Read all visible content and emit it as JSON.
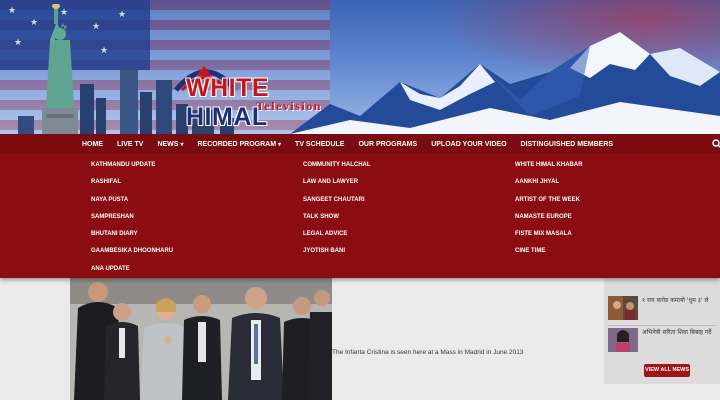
{
  "brand": {
    "logo_main_white": "WHITE",
    "logo_main_himal": " HIMAL",
    "logo_sub": "Television"
  },
  "nav": {
    "items": [
      {
        "label": "HOME"
      },
      {
        "label": "LIVE TV"
      },
      {
        "label": "NEWS",
        "caret": "▾"
      },
      {
        "label": "RECORDED PROGRAM",
        "caret": "▾"
      },
      {
        "label": "TV SCHEDULE"
      },
      {
        "label": "OUR PROGRAMS"
      },
      {
        "label": "UPLOAD YOUR VIDEO"
      },
      {
        "label": "DISTINGUISHED MEMBERS"
      }
    ],
    "search_icon": "search-icon"
  },
  "dropdown": {
    "col1": [
      "KATHMANDU UPDATE",
      "RASHIFAL",
      "NAYA PUSTA",
      "SAMPRESHAN",
      "BHUTANI DIARY",
      "GAAMBESIKA DHOONHARU",
      "ANA UPDATE"
    ],
    "col2": [
      "COMMUNITY HALCHAL",
      "LAW AND LAWYER",
      "SANGEET CHAUTARI",
      "TALK SHOW",
      "LEGAL ADVICE",
      "JYOTISH BANI"
    ],
    "col3": [
      "WHITE HIMAL KHABAR",
      "AANKHI JHYAL",
      "ARTIST OF THE WEEK",
      "NAMASTE EUROPE",
      "FISTE MIX MASALA",
      "CINE TIME"
    ]
  },
  "article": {
    "caption": "The Infanta Cristina is seen here at a Mass in Madrid in June 2013"
  },
  "sidebar": {
    "news": [
      {
        "title": "१ सय करोड कमायो 'धुम ३' ले"
      },
      {
        "title": "अभिनेत्री सरिता शिवा बिबाह गर्दै"
      }
    ],
    "view_all_label": "VIEW ALL NEWS"
  },
  "colors": {
    "nav_bg": "#7a0c10",
    "dropdown_bg": "#8c0d11",
    "button_red": "#a0151a"
  }
}
